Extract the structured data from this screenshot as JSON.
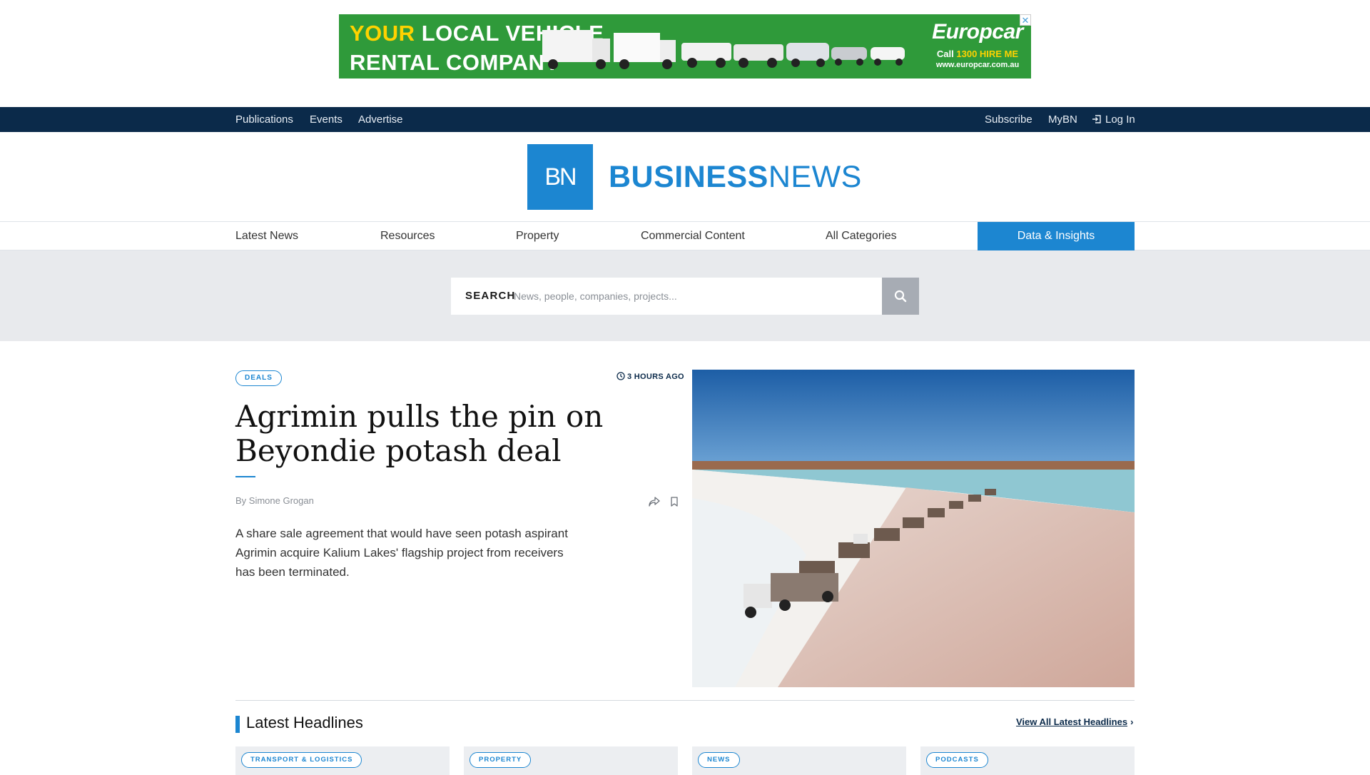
{
  "ad": {
    "line1_highlight": "YOUR",
    "line1_rest": " LOCAL VEHICLE",
    "line2": "RENTAL COMPANY",
    "brand": "Europcar",
    "call_prefix": "Call ",
    "call_number": "1300 HIRE ME",
    "url": "www.europcar.com.au",
    "close": "✕"
  },
  "topbar": {
    "left": [
      "Publications",
      "Events",
      "Advertise"
    ],
    "subscribe": "Subscribe",
    "mybn": "MyBN",
    "login": "Log In"
  },
  "logo": {
    "mark": "BN",
    "name_bold": "BUSINESS",
    "name_light": "NEWS"
  },
  "nav": {
    "items": [
      "Latest News",
      "Resources",
      "Property",
      "Commercial Content",
      "All Categories"
    ],
    "cta": "Data & Insights"
  },
  "search": {
    "label": "SEARCH",
    "placeholder": "News, people, companies, projects..."
  },
  "feature": {
    "tag": "DEALS",
    "time": "3 HOURS AGO",
    "headline": "Agrimin pulls the pin on Beyondie potash deal",
    "byline": "By Simone Grogan",
    "summary": "A share sale agreement that would have seen potash aspirant Agrimin acquire Kalium Lakes' flagship project from receivers has been terminated."
  },
  "latest": {
    "title": "Latest Headlines",
    "view_all": "View All Latest Headlines",
    "cards": [
      {
        "tag": "TRANSPORT & LOGISTICS"
      },
      {
        "tag": "PROPERTY"
      },
      {
        "tag": "NEWS"
      },
      {
        "tag": "PODCASTS"
      }
    ]
  },
  "colors": {
    "brand_blue": "#1c86d1",
    "navy": "#0b2a4a",
    "ad_green": "#2f9a3a"
  }
}
